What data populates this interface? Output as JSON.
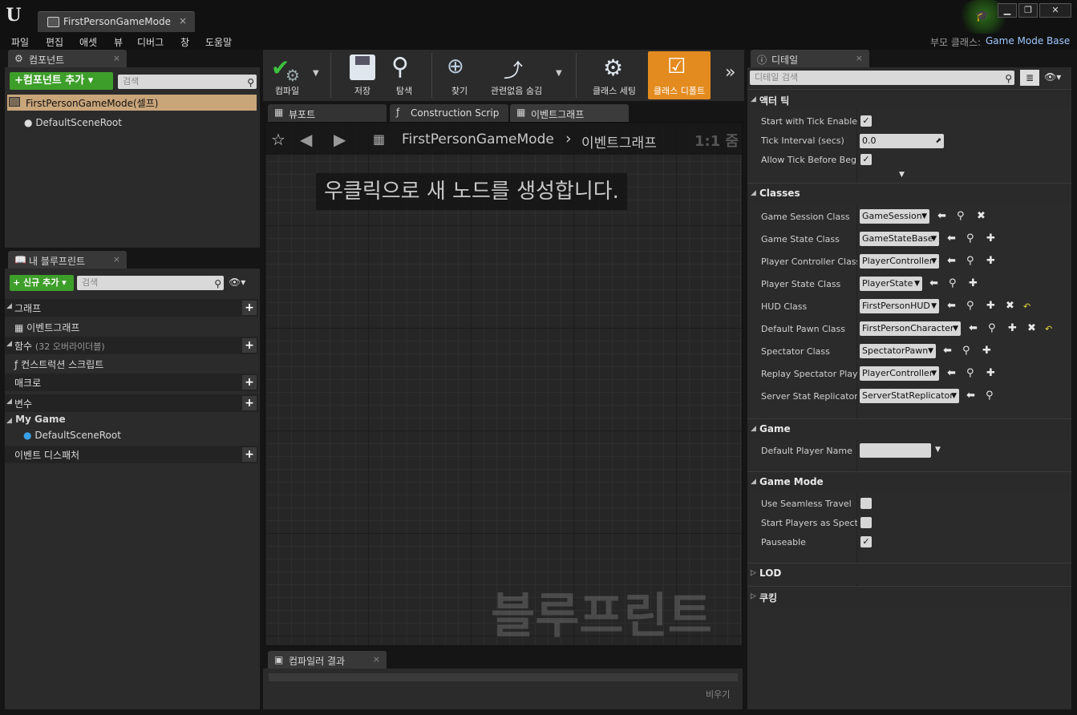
{
  "window": {
    "tab_title": "FirstPersonGameMode",
    "tab_close": "×",
    "logo": "U",
    "minimize": "▁",
    "restore": "❐",
    "close": "✕"
  },
  "menu": {
    "items": [
      "파일",
      "편집",
      "애셋",
      "뷰",
      "디버그",
      "창",
      "도움말"
    ],
    "parent_class_label": "부모 클래스:",
    "parent_class_value": "Game Mode Base"
  },
  "components_panel": {
    "tab_label": "컴포넌트",
    "add_button": "+컴포넌트 추가 ▾",
    "search_placeholder": "검색",
    "self_item": "FirstPersonGameMode(셀프)",
    "root_item": "DefaultSceneRoot"
  },
  "my_blueprint_panel": {
    "tab_label": "내 블루프린트",
    "add_new_button": "+ 신규 추가 ▾",
    "search_placeholder": "검색",
    "sections": {
      "graphs": "그래프",
      "graph_item": "이벤트그래프",
      "functions": "함수",
      "functions_overridable": "(32 오버라이더블)",
      "function_item": "컨스트럭션 스크립트",
      "macros": "매크로",
      "variables": "변수",
      "my_game_category": "My Game",
      "variable_item": "DefaultSceneRoot",
      "event_dispatchers": "이벤트 디스패처"
    }
  },
  "toolbar": {
    "compile": "컴파일",
    "save": "저장",
    "browse": "탐색",
    "find": "찾기",
    "hide_unrelated": "관련없음 숨김",
    "class_settings": "클래스 세팅",
    "class_defaults": "클래스 디폴트",
    "more": "»"
  },
  "graph_tabs": {
    "viewport": "뷰포트",
    "construction": "Construction Scrip",
    "event_graph": "이벤트그래프"
  },
  "graph": {
    "breadcrumb_root": "FirstPersonGameMode",
    "breadcrumb_sep": "›",
    "breadcrumb_current": "이벤트그래프",
    "zoom": "1:1 줌",
    "hint": "우클릭으로 새 노드를 생성합니다.",
    "watermark": "블루프린트"
  },
  "compiler_results": {
    "tab_label": "컴파일러 결과",
    "clear_button": "비우기"
  },
  "details_panel": {
    "tab_label": "디테일",
    "search_placeholder": "디테일 검색",
    "actor_tick": {
      "header": "액터 틱",
      "start_with_tick": "Start with Tick Enabled",
      "tick_interval": "Tick Interval (secs)",
      "tick_interval_value": "0.0",
      "allow_tick": "Allow Tick Before Begin"
    },
    "classes": {
      "header": "Classes",
      "rows": [
        {
          "label": "Game Session Class",
          "value": "GameSession"
        },
        {
          "label": "Game State Class",
          "value": "GameStateBase"
        },
        {
          "label": "Player Controller Class",
          "value": "PlayerController"
        },
        {
          "label": "Player State Class",
          "value": "PlayerState"
        },
        {
          "label": "HUD Class",
          "value": "FirstPersonHUD"
        },
        {
          "label": "Default Pawn Class",
          "value": "FirstPersonCharacter"
        },
        {
          "label": "Spectator Class",
          "value": "SpectatorPawn"
        },
        {
          "label": "Replay Spectator Player",
          "value": "PlayerController"
        },
        {
          "label": "Server Stat Replicator C",
          "value": "ServerStatReplicator"
        }
      ]
    },
    "game": {
      "header": "Game",
      "default_player_name": "Default Player Name"
    },
    "game_mode": {
      "header": "Game Mode",
      "use_seamless": "Use Seamless Travel",
      "start_players": "Start Players as Specta",
      "pauseable": "Pauseable"
    },
    "lod": "LOD",
    "cooking": "쿠킹"
  },
  "colors": {
    "accent_green": "#3e9e2a",
    "class_defaults_orange": "#e38b1f",
    "selection_tan": "#c9a57a",
    "link_blue": "#9fc8ff"
  }
}
